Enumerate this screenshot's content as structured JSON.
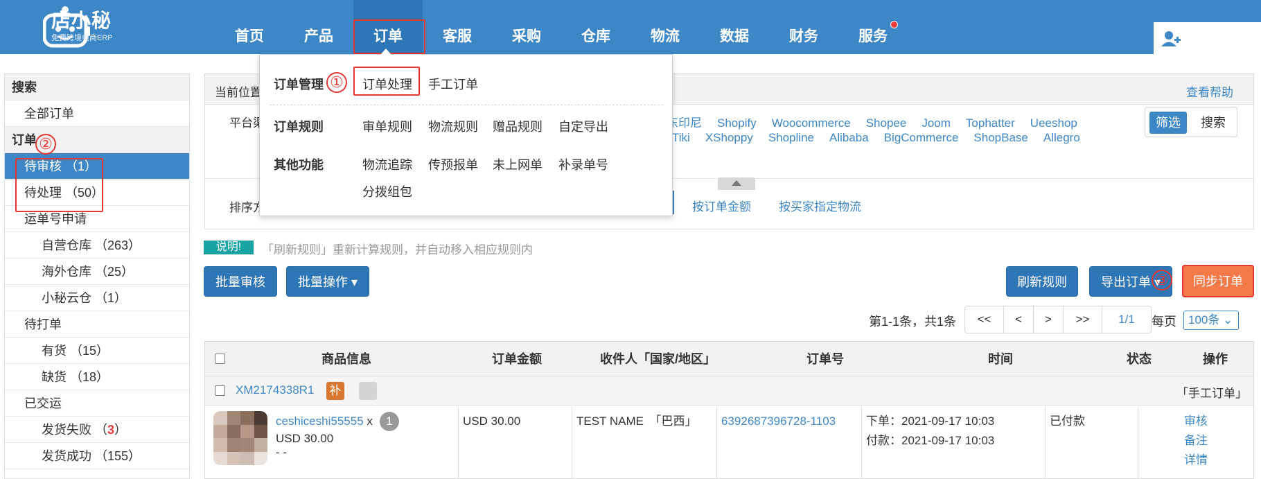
{
  "header": {
    "logo_text": "店小秘",
    "logo_sub": "免费跨境电商ERP",
    "nav": [
      "首页",
      "产品",
      "订单",
      "客服",
      "采购",
      "仓库",
      "物流",
      "数据",
      "财务",
      "服务"
    ],
    "active_nav": "订单"
  },
  "sidebar": {
    "search_head": "搜索",
    "all_orders": "全部订单",
    "order_head": "订单",
    "pending_review": "待审核 （1）",
    "pending_process": "待处理 （50）",
    "waybill_apply": "运单号申请",
    "own_warehouse": "自营仓库 （263）",
    "overseas_warehouse": "海外仓库 （25）",
    "xiaomi_cloud": "小秘云仓 （1）",
    "to_print": "待打单",
    "in_stock": "有货 （15）",
    "out_stock": "缺货 （18）",
    "shipped": "已交运",
    "ship_failed_label": "发货失败 （",
    "ship_failed_num": "3",
    "ship_failed_close": "）",
    "ship_success": "发货成功 （155）",
    "annotation_2": "②"
  },
  "panel": {
    "current_position": "当前位置",
    "help": "查看帮助",
    "platform_label": "平台渠",
    "sort_label": "排序方",
    "platforms_row1": [
      "东印尼",
      "Shopify",
      "Woocommerce",
      "Shopee",
      "Joom",
      "Tophatter",
      "Ueeshop"
    ],
    "platforms_row2": [
      "Tiki",
      "XShoppy",
      "Shopline",
      "Alibaba",
      "BigCommerce",
      "ShopBase",
      "Allegro"
    ],
    "sort_options": [
      "按订单金额",
      "按买家指定物流"
    ],
    "filter_btn": "筛选",
    "search_btn": "搜索"
  },
  "dropdown": {
    "groups": [
      {
        "label": "订单管理",
        "items": [
          "订单处理",
          "手工订单"
        ]
      },
      {
        "label": "订单规则",
        "items": [
          "审单规则",
          "物流规则",
          "赠品规则",
          "自定导出"
        ]
      },
      {
        "label": "其他功能",
        "items": [
          "物流追踪",
          "传预报单",
          "未上网单",
          "补录单号",
          "分拨组包"
        ]
      }
    ],
    "annotation_1": "①"
  },
  "notice": {
    "badge": "说明!",
    "text": "「刷新规则」重新计算规则，并自动移入相应规则内"
  },
  "toolbar": {
    "batch_review": "批量审核",
    "batch_ops": "批量操作 ▾",
    "refresh_rules": "刷新规则",
    "export_orders": "导出订单 ▾",
    "sync_orders": "同步订单",
    "annotation_3": "③"
  },
  "pager": {
    "info": "第1-1条，共1条",
    "first": "<<",
    "prev": "<",
    "next": ">",
    "last": ">>",
    "current": "1/1",
    "per_page_label": "每页",
    "per_page_value": "100条 ⌄"
  },
  "table": {
    "headers": [
      "商品信息",
      "订单金额",
      "收件人「国家/地区」",
      "订单号",
      "时间",
      "状态",
      "操作"
    ],
    "order_id": "XM2174338R1",
    "bu_badge": "补",
    "order_type": "「手工订单」",
    "product_name": "ceshiceshi55555",
    "qty_x": "x",
    "qty": "1",
    "product_price": "USD 30.00",
    "product_sku": "- -",
    "amount": "USD 30.00",
    "recipient": "TEST NAME　「巴西」",
    "order_no": "6392687396728-1103",
    "time_order": "下单：2021-09-17 10:03",
    "time_paid": "付款：2021-09-17 10:03",
    "status": "已付款",
    "actions": [
      "审核",
      "备注",
      "详情"
    ]
  },
  "colors": {
    "brand_blue": "#3d87c7",
    "annotation_red": "#e53935",
    "sync_orange": "#f47a4a"
  }
}
